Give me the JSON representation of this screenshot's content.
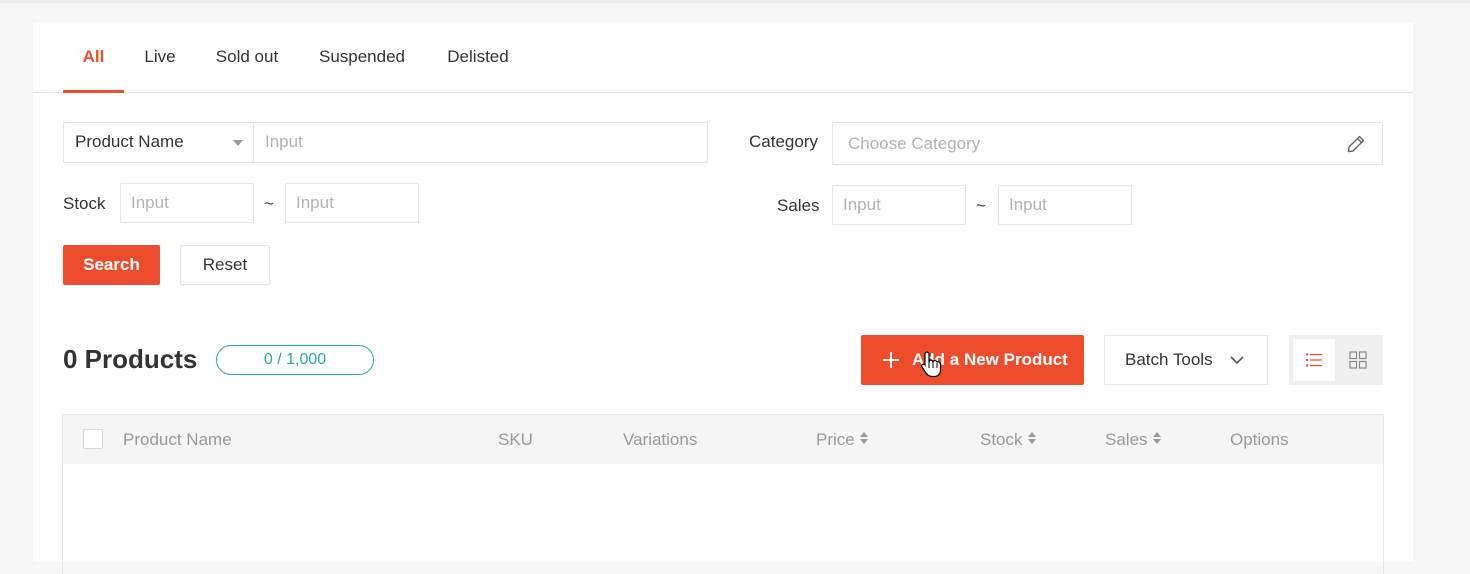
{
  "tabs": [
    {
      "label": "All",
      "active": true
    },
    {
      "label": "Live"
    },
    {
      "label": "Sold out"
    },
    {
      "label": "Suspended"
    },
    {
      "label": "Delisted"
    }
  ],
  "filters": {
    "search_field": {
      "selected": "Product Name",
      "placeholder": "Input"
    },
    "category": {
      "label": "Category",
      "placeholder": "Choose Category"
    },
    "stock": {
      "label": "Stock",
      "min_placeholder": "Input",
      "max_placeholder": "Input",
      "separator": "~"
    },
    "sales": {
      "label": "Sales",
      "min_placeholder": "Input",
      "max_placeholder": "Input",
      "separator": "~"
    },
    "search_button": "Search",
    "reset_button": "Reset"
  },
  "products": {
    "count_label": "0 Products",
    "quota": "0 / 1,000",
    "add_button": "Add a New Product",
    "batch_tools": "Batch Tools"
  },
  "table": {
    "columns": [
      "Product Name",
      "SKU",
      "Variations",
      "Price",
      "Stock",
      "Sales",
      "Options"
    ]
  },
  "colors": {
    "accent": "#ee4d2d",
    "quota": "#26aa99"
  }
}
